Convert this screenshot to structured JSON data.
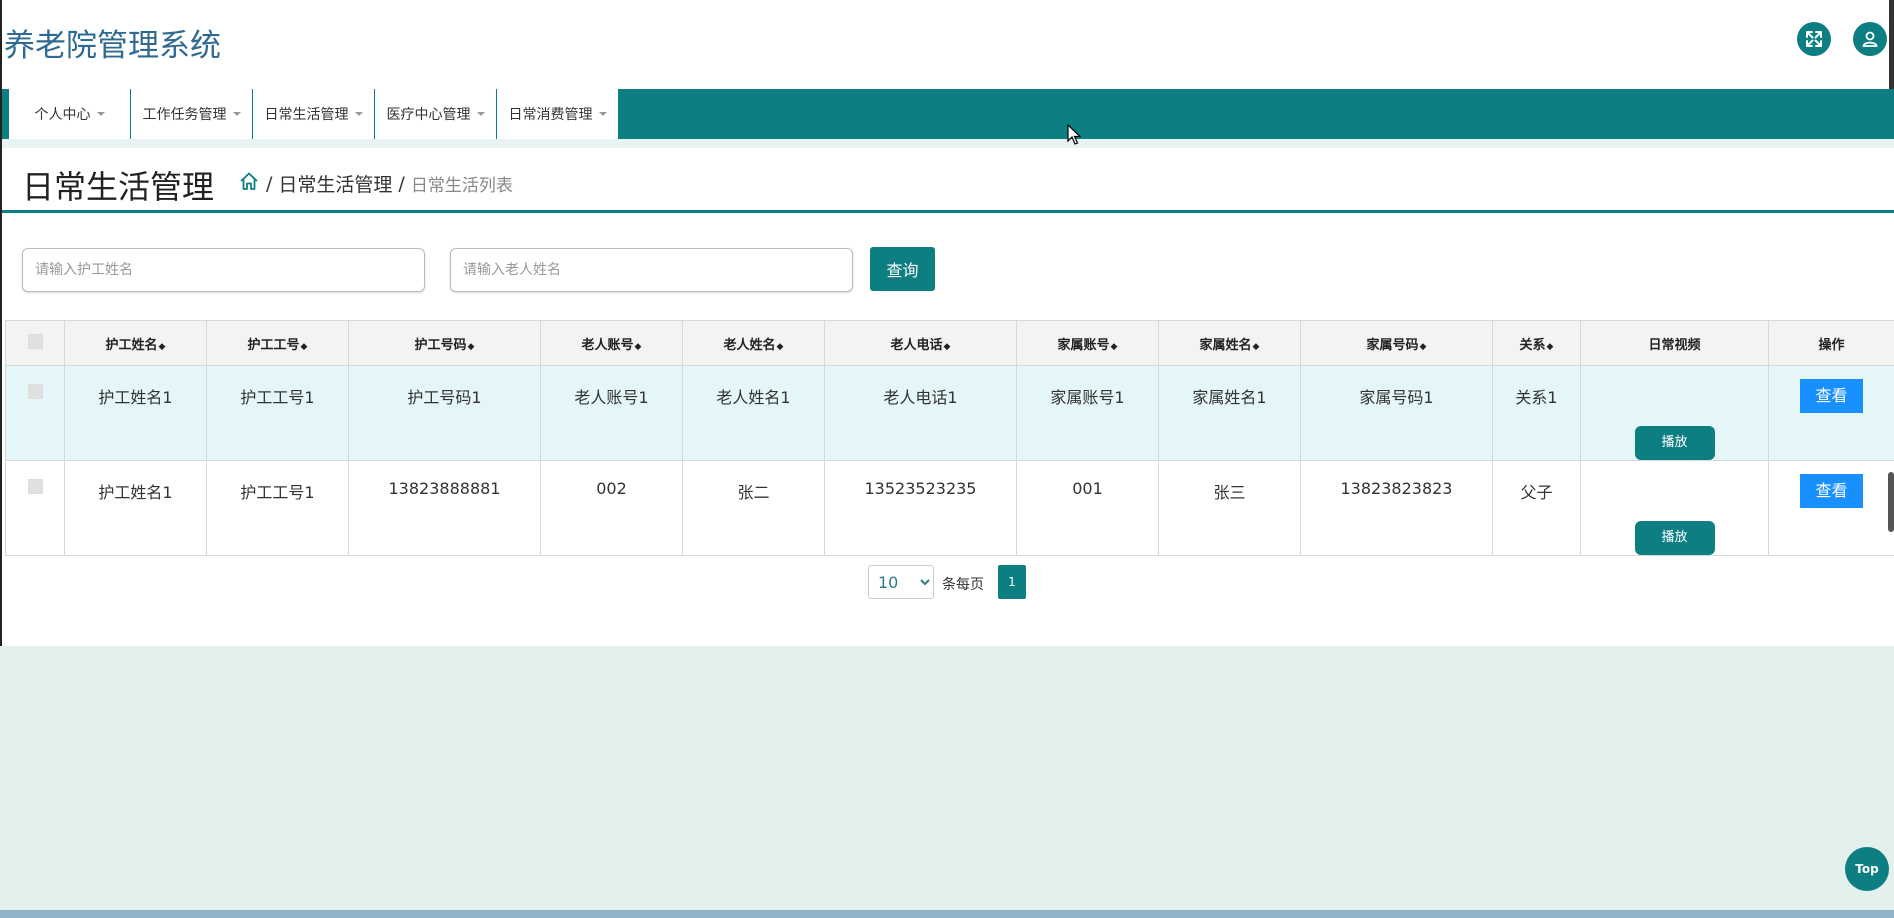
{
  "header": {
    "app_title": "养老院管理系统",
    "fullscreen_icon": "expand-icon",
    "user_icon": "user-icon"
  },
  "nav": {
    "items": [
      {
        "label": "个人中心"
      },
      {
        "label": "工作任务管理"
      },
      {
        "label": "日常生活管理"
      },
      {
        "label": "医疗中心管理"
      },
      {
        "label": "日常消费管理"
      }
    ]
  },
  "page": {
    "title": "日常生活管理",
    "breadcrumb": {
      "home_icon": "home-icon",
      "section": "日常生活管理",
      "current": "日常生活列表",
      "sep": "/"
    }
  },
  "search": {
    "caregiver_placeholder": "请输入护工姓名",
    "elder_placeholder": "请输入老人姓名",
    "button": "查询"
  },
  "table": {
    "columns": [
      "护工姓名",
      "护工工号",
      "护工号码",
      "老人账号",
      "老人姓名",
      "老人电话",
      "家属账号",
      "家属姓名",
      "家属号码",
      "关系",
      "日常视频",
      "操作"
    ],
    "rows": [
      {
        "cells": [
          "护工姓名1",
          "护工工号1",
          "护工号码1",
          "老人账号1",
          "老人姓名1",
          "老人电话1",
          "家属账号1",
          "家属姓名1",
          "家属号码1",
          "关系1"
        ],
        "play": "播放",
        "view": "查看"
      },
      {
        "cells": [
          "护工姓名1",
          "护工工号1",
          "13823888881",
          "002",
          "张二",
          "13523523235",
          "001",
          "张三",
          "13823823823",
          "父子"
        ],
        "play": "播放",
        "view": "查看"
      }
    ]
  },
  "pagination": {
    "page_size": "10",
    "per_page_label": "条每页",
    "current_page": "1"
  },
  "top_button": "Top",
  "colors": {
    "primary": "#0d7f83",
    "view_button": "#1890ff",
    "title": "#2f6a93"
  }
}
